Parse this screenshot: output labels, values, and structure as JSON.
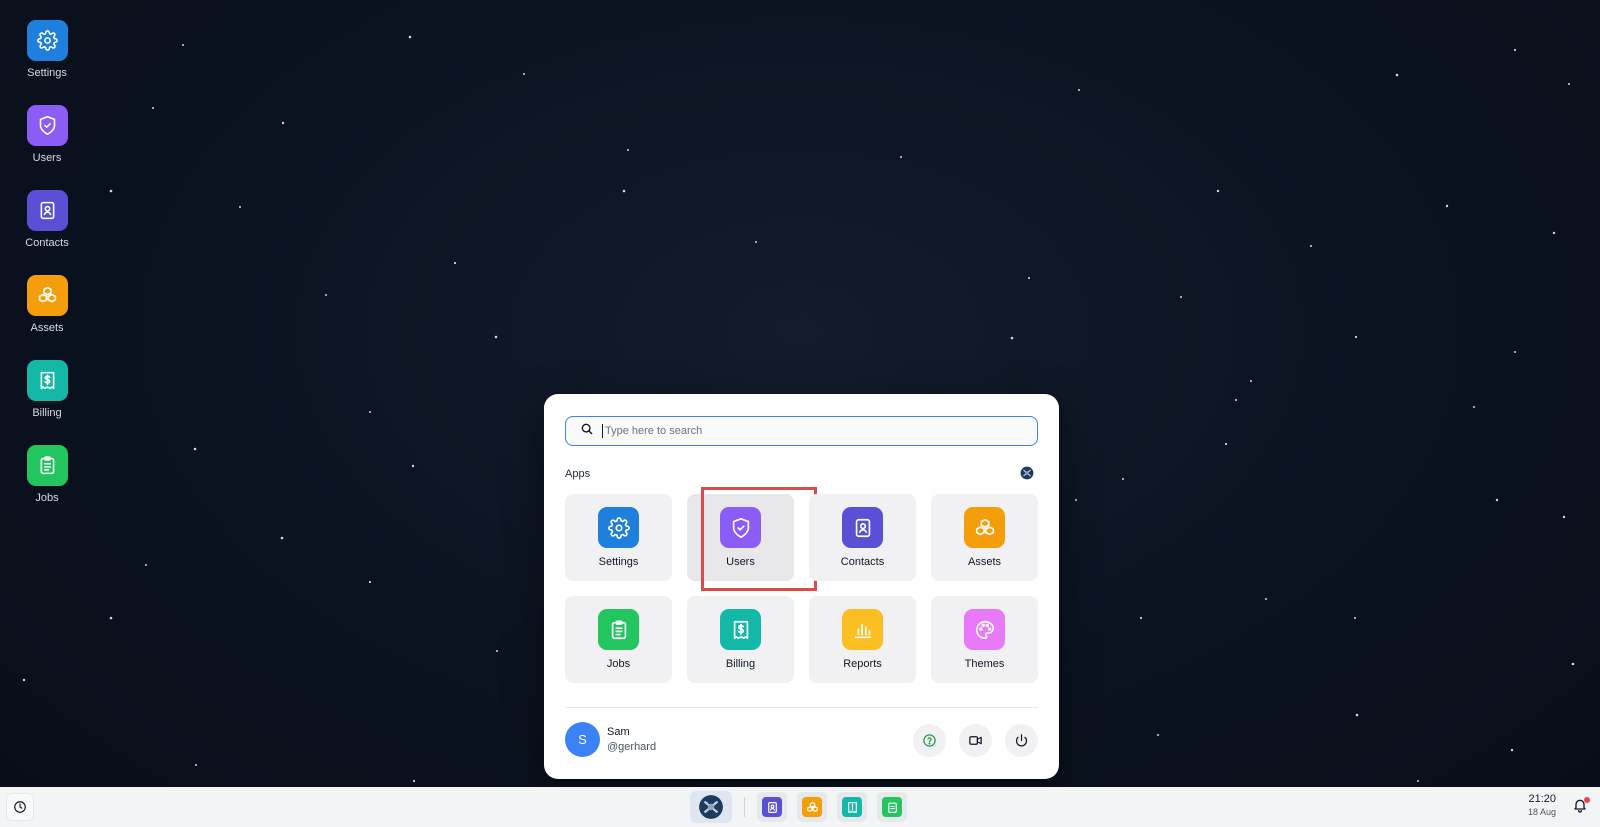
{
  "colors": {
    "settings": "#1f7fdc",
    "users": "#8b5cf6",
    "contacts": "#5b4fd6",
    "assets": "#f59e0b",
    "billing": "#14b8a6",
    "jobs": "#22c55e",
    "reports": "#fbbf24",
    "themes": "#e879f9",
    "selection_outline": "#dc4b4b",
    "accent": "#3b82f6"
  },
  "desktop": {
    "icons": [
      {
        "label": "Settings",
        "icon": "gear-icon"
      },
      {
        "label": "Users",
        "icon": "shield-icon"
      },
      {
        "label": "Contacts",
        "icon": "contact-book-icon"
      },
      {
        "label": "Assets",
        "icon": "boxes-icon"
      },
      {
        "label": "Billing",
        "icon": "receipt-dollar-icon"
      },
      {
        "label": "Jobs",
        "icon": "clipboard-icon"
      }
    ]
  },
  "launcher": {
    "search": {
      "placeholder": "Type here to search",
      "value": ""
    },
    "apps_title": "Apps",
    "apps": [
      {
        "label": "Settings",
        "icon": "gear-icon"
      },
      {
        "label": "Users",
        "icon": "shield-icon",
        "selected": true
      },
      {
        "label": "Contacts",
        "icon": "contact-book-icon"
      },
      {
        "label": "Assets",
        "icon": "boxes-icon"
      },
      {
        "label": "Jobs",
        "icon": "clipboard-icon"
      },
      {
        "label": "Billing",
        "icon": "receipt-dollar-icon"
      },
      {
        "label": "Reports",
        "icon": "bar-chart-icon"
      },
      {
        "label": "Themes",
        "icon": "palette-icon"
      }
    ],
    "user": {
      "initial": "S",
      "name": "Sam",
      "handle": "@gerhard"
    },
    "actions": [
      "help-icon",
      "video-icon",
      "power-icon"
    ]
  },
  "taskbar": {
    "time": "21:20",
    "date": "18 Aug",
    "pinned": [
      "contact-book-icon",
      "boxes-icon",
      "receipt-dollar-icon",
      "clipboard-icon"
    ]
  }
}
